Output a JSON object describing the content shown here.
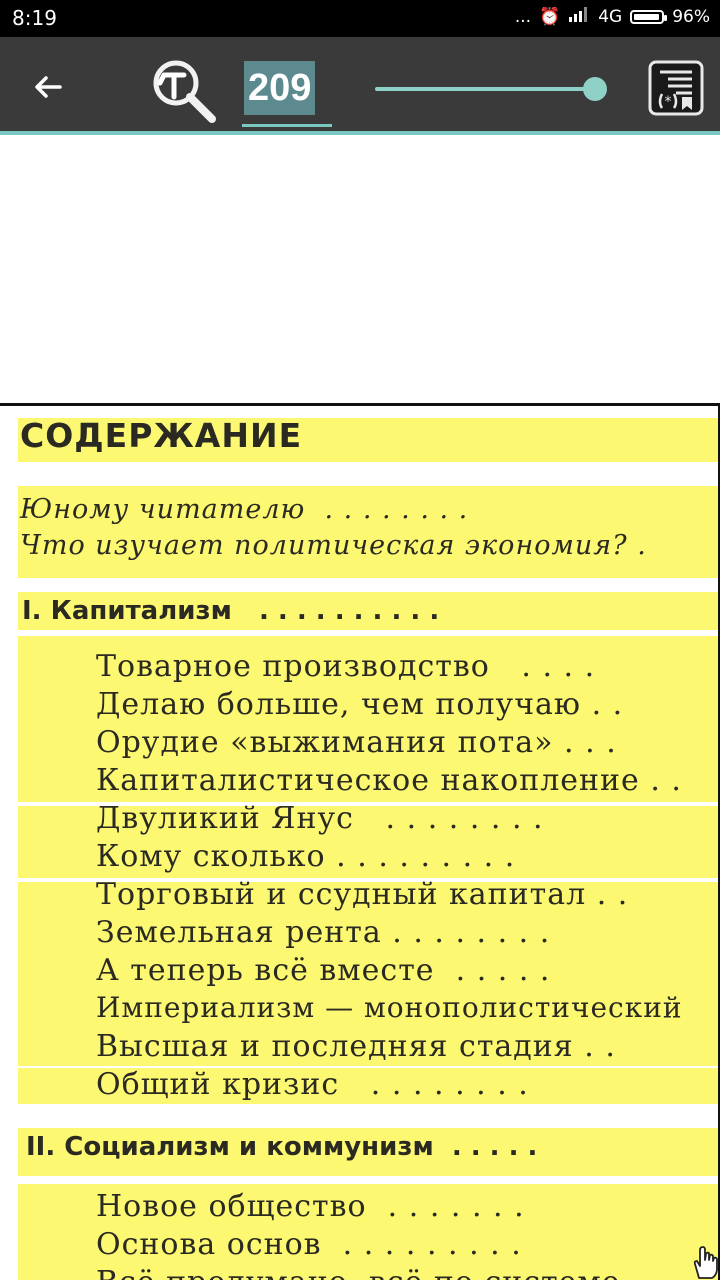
{
  "status_bar": {
    "time": "8:19",
    "dots": "...",
    "network": "4G",
    "battery": "96%",
    "battery_level": 0.96
  },
  "toolbar": {
    "back_icon": "arrow-left-icon",
    "zoom_icon": "magnifier-hammer-icon",
    "page_number": "209",
    "slider_position": 1.0,
    "bookmarks_icon": "bookmark-list-icon",
    "colors": {
      "bar": "#3a3a3a",
      "accent": "#7ac9c0",
      "highlight": "#fdf871"
    }
  },
  "document": {
    "heading": "СОДЕРЖАНИЕ",
    "intro": [
      {
        "text": "Юному читателю",
        "dots": ". . . . . . . ."
      },
      {
        "text": "Что изучает политическая экономия?",
        "dots": "."
      }
    ],
    "part1": {
      "title": "I. Капитализм",
      "dots": ". . . . . . . . . ."
    },
    "part1_items": [
      {
        "text": "Товарное производство",
        "dots": ". . . ."
      },
      {
        "text": "Делаю больше, чем получаю",
        "dots": ". ."
      },
      {
        "text": "Орудие «выжимания пота»",
        "dots": ". . ."
      },
      {
        "text": "Капиталистическое накопление",
        "dots": ". ."
      },
      {
        "text": "Двуликий Янус",
        "dots": ". . . . . . . ."
      },
      {
        "text": "Кому сколько",
        "dots": ". . . . . . . . ."
      },
      {
        "text": "Торговый и ссудный капитал",
        "dots": ". ."
      },
      {
        "text": "Земельная рента",
        "dots": ". . . . . . . ."
      },
      {
        "text": "А теперь всё вместе",
        "dots": ". . . . ."
      },
      {
        "text": "Империализм — монополистический",
        "dots": ""
      },
      {
        "text": "Высшая и последняя стадия",
        "dots": ". ."
      },
      {
        "text": "Общий кризис",
        "dots": ". . . . . . . ."
      }
    ],
    "part2": {
      "title": "II. Социализм и коммунизм",
      "dots": ". . . . ."
    },
    "part2_items": [
      {
        "text": "Новое общество",
        "dots": ". . . . . . ."
      },
      {
        "text": "Основа основ",
        "dots": ". . . . . . . . ."
      },
      {
        "text": "Всё продумано, всё по системе",
        "dots": ""
      }
    ]
  }
}
